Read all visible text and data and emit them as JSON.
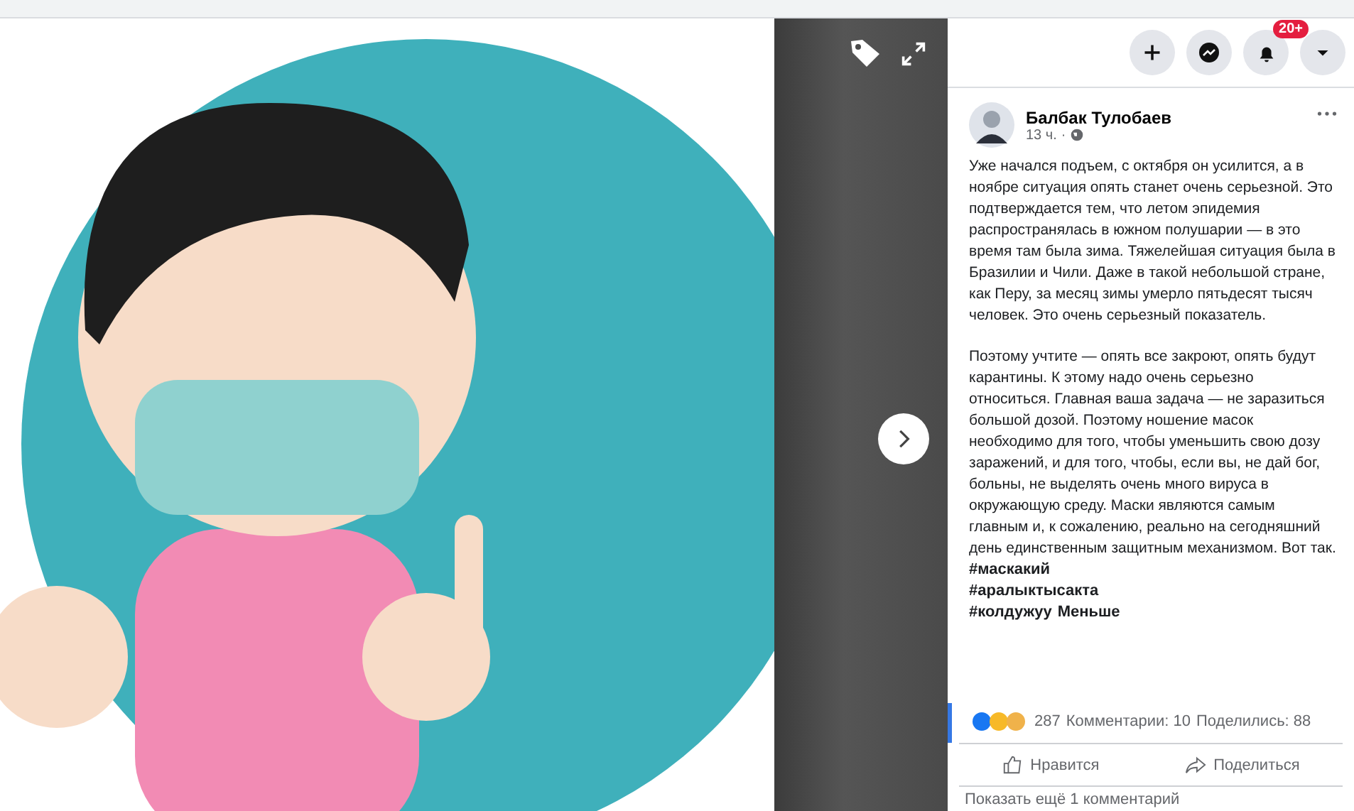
{
  "top_buttons": [
    {
      "kind": "plus"
    },
    {
      "kind": "messenger"
    },
    {
      "kind": "bell",
      "badge": "20+"
    },
    {
      "kind": "caret"
    }
  ],
  "post": {
    "author": "Балбак Тулобаев",
    "time": "13 ч.",
    "separator": "·",
    "paragraphs": [
      "Уже начался подъем, с октября он усилится, а в ноябре ситуация опять станет очень серьезной. Это подтверждается тем, что летом эпидемия распространялась в южном полушарии — в это время там была зима. Тяжелейшая ситуация была в Бразилии и Чили. Даже в такой небольшой стране, как Перу, за месяц зимы умерло пятьдесят тысяч человек. Это очень серьезный показатель.",
      "Поэтому учтите — опять все закроют, опять будут карантины. К этому надо очень серьезно относиться. Главная ваша задача — не заразиться большой дозой. Поэтому ношение масок необходимо для того, чтобы уменьшить свою дозу заражений, и для того, чтобы, если вы, не дай бог, больны, не выделять очень много вируса в окружающую среду. Маски являются самым главным и, к сожалению, реально на сегодняшний день единственным защитным механизмом. Вот так."
    ],
    "hashtags": [
      "#маскакий",
      "#аралыктысакта",
      "#колдужуу"
    ],
    "more_link": "Меньше",
    "reactions_count": "287",
    "comments": "Комментарии: 10",
    "shares": "Поделились: 88",
    "actions": [
      {
        "kind": "like",
        "label": "Нравится"
      },
      {
        "kind": "share",
        "label": "Поделиться"
      }
    ],
    "show_comments": "Показать ещё 1 комментарий"
  }
}
